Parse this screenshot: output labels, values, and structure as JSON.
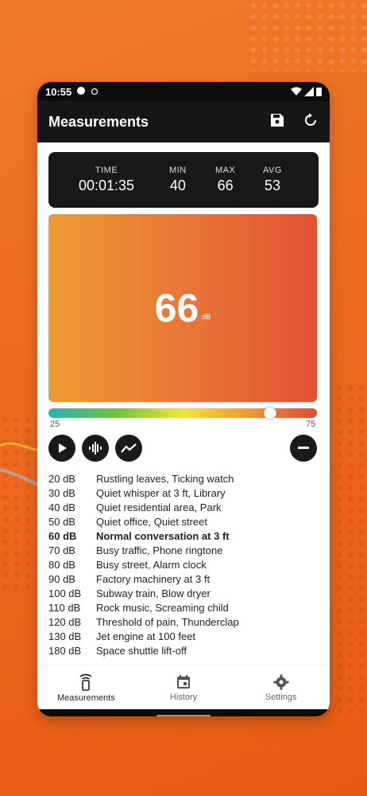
{
  "status_bar": {
    "time": "10:55"
  },
  "appbar": {
    "title": "Measurements",
    "save_icon": "save-icon",
    "reset_icon": "refresh-icon"
  },
  "stats": [
    {
      "label": "TIME",
      "value": "00:01:35"
    },
    {
      "label": "MIN",
      "value": "40"
    },
    {
      "label": "MAX",
      "value": "66"
    },
    {
      "label": "AVG",
      "value": "53"
    }
  ],
  "meter": {
    "value": "66",
    "unit": "dB"
  },
  "scale": {
    "min_label": "25",
    "max_label": "75",
    "current": 66,
    "min": 25,
    "max": 75
  },
  "controls": {
    "play_icon": "play-icon",
    "waveform_icon": "waveform-icon",
    "trend_icon": "trend-icon",
    "minus_icon": "minus-icon"
  },
  "reference": [
    {
      "db": "20 dB",
      "desc": "Rustling leaves, Ticking watch"
    },
    {
      "db": "30 dB",
      "desc": "Quiet whisper at 3 ft, Library"
    },
    {
      "db": "40 dB",
      "desc": "Quiet residential area, Park"
    },
    {
      "db": "50 dB",
      "desc": "Quiet office, Quiet street"
    },
    {
      "db": "60 dB",
      "desc": "Normal conversation at 3 ft"
    },
    {
      "db": "70 dB",
      "desc": "Busy traffic, Phone ringtone"
    },
    {
      "db": "80 dB",
      "desc": "Busy street, Alarm clock"
    },
    {
      "db": "90 dB",
      "desc": "Factory machinery at 3 ft"
    },
    {
      "db": "100 dB",
      "desc": "Subway train, Blow dryer"
    },
    {
      "db": "110 dB",
      "desc": "Rock music, Screaming child"
    },
    {
      "db": "120 dB",
      "desc": "Threshold of pain, Thunderclap"
    },
    {
      "db": "130 dB",
      "desc": "Jet engine at 100 feet"
    },
    {
      "db": "180 dB",
      "desc": "Space shuttle lift-off"
    }
  ],
  "nav": [
    {
      "label": "Measurements",
      "icon": "sound-meter-icon",
      "active": true
    },
    {
      "label": "History",
      "icon": "calendar-icon",
      "active": false
    },
    {
      "label": "Settings",
      "icon": "gear-icon",
      "active": false
    }
  ],
  "colors": {
    "accent_dark": "#161616",
    "meter_start": "#ec9a35",
    "meter_end": "#e45134",
    "background": "#ee6a1f"
  }
}
